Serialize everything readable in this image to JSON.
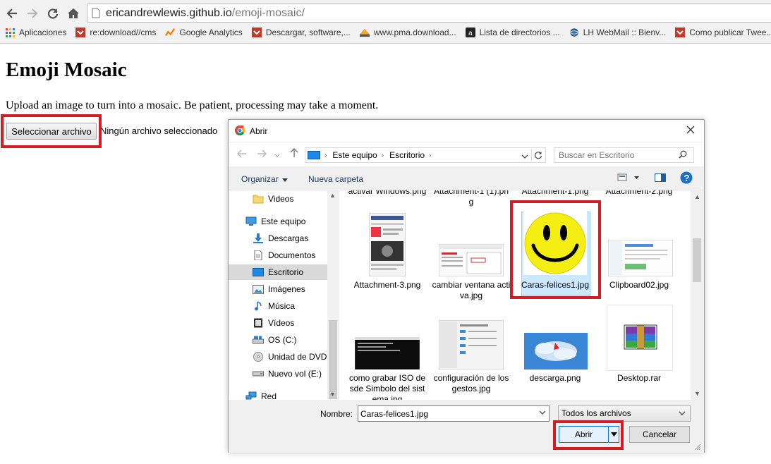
{
  "browser": {
    "url_host": "ericandrewlewis.github.io",
    "url_path": "/emoji-mosaic/",
    "bookmarks": [
      {
        "label": "Aplicaciones",
        "icon": "apps-grid-icon"
      },
      {
        "label": "re:download//cms",
        "icon": "bookmark-favicon-icon"
      },
      {
        "label": "Google Analytics",
        "icon": "analytics-icon"
      },
      {
        "label": "Descargar, software,...",
        "icon": "bookmark-favicon-icon"
      },
      {
        "label": "www.pma.download...",
        "icon": "pma-icon"
      },
      {
        "label": "Lista de directorios ...",
        "icon": "amazon-icon"
      },
      {
        "label": "LH WebMail :: Bienv...",
        "icon": "webmail-icon"
      },
      {
        "label": "Como publicar Twee...",
        "icon": "bookmark-favicon-icon"
      }
    ]
  },
  "page": {
    "title": "Emoji Mosaic",
    "description": "Upload an image to turn into a mosaic. Be patient, processing may take a moment.",
    "file_button": "Seleccionar archivo",
    "file_status": "Ningún archivo seleccionado"
  },
  "dialog": {
    "title": "Abrir",
    "breadcrumb": [
      "Este equipo",
      "Escritorio"
    ],
    "search_placeholder": "Buscar en Escritorio",
    "organize": "Organizar",
    "new_folder": "Nueva carpeta",
    "nav_items": [
      {
        "label": "Videos",
        "icon": "folder-icon"
      },
      {
        "label": "Este equipo",
        "icon": "computer-icon"
      },
      {
        "label": "Descargas",
        "icon": "download-icon"
      },
      {
        "label": "Documentos",
        "icon": "documents-icon"
      },
      {
        "label": "Escritorio",
        "icon": "desktop-icon"
      },
      {
        "label": "Imágenes",
        "icon": "pictures-icon"
      },
      {
        "label": "Música",
        "icon": "music-icon"
      },
      {
        "label": "Vídeos",
        "icon": "videos-icon"
      },
      {
        "label": "OS (C:)",
        "icon": "drive-icon"
      },
      {
        "label": "Unidad de DVD R",
        "icon": "dvd-icon"
      },
      {
        "label": "Nuevo vol (E:)",
        "icon": "drive-icon"
      },
      {
        "label": "Red",
        "icon": "network-icon"
      }
    ],
    "files": [
      {
        "label": "activar Windows.png"
      },
      {
        "label": "Attachment-1 (1).png"
      },
      {
        "label": "Attachment-1.png"
      },
      {
        "label": "Attachment-2.png"
      },
      {
        "label": "Attachment-3.png"
      },
      {
        "label": "cambiar ventana activa.jpg"
      },
      {
        "label": "Caras-felices1.jpg"
      },
      {
        "label": "Clipboard02.jpg"
      },
      {
        "label": "como grabar ISO desde Simbolo del sistema.jpg"
      },
      {
        "label": "configuración de los gestos.jpg"
      },
      {
        "label": "descarga.png"
      },
      {
        "label": "Desktop.rar"
      }
    ],
    "name_label": "Nombre:",
    "name_value": "Caras-felices1.jpg",
    "file_type": "Todos los archivos",
    "open_button": "Abrir",
    "cancel_button": "Cancelar"
  },
  "colors": {
    "highlight": "#d21d25",
    "selection": "#cce8ff",
    "accent": "#0078d7"
  }
}
